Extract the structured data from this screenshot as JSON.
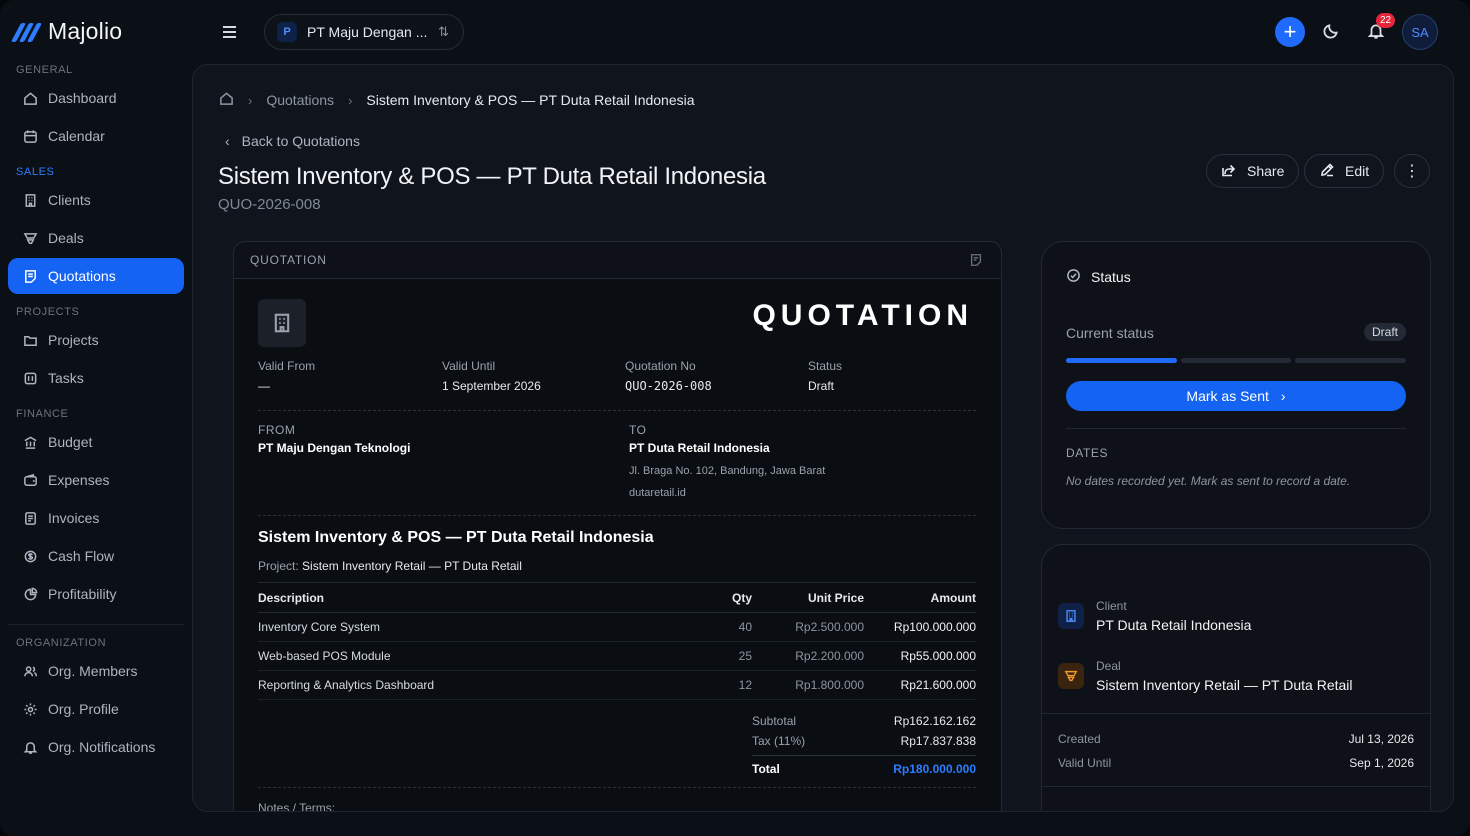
{
  "app": {
    "name": "Majolio"
  },
  "sidebar": {
    "sections": {
      "general": "GENERAL",
      "sales": "SALES",
      "projects": "PROJECTS",
      "finance": "FINANCE",
      "organization": "ORGANIZATION"
    },
    "items": {
      "dashboard": "Dashboard",
      "calendar": "Calendar",
      "clients": "Clients",
      "deals": "Deals",
      "quotations": "Quotations",
      "projects": "Projects",
      "tasks": "Tasks",
      "budget": "Budget",
      "expenses": "Expenses",
      "invoices": "Invoices",
      "cashflow": "Cash Flow",
      "profitability": "Profitability",
      "members": "Org. Members",
      "profile": "Org. Profile",
      "notifications": "Org. Notifications"
    }
  },
  "topbar": {
    "org_initial": "P",
    "org_name": "PT Maju Dengan ...",
    "notification_count": "22",
    "avatar_initials": "SA",
    "accent": "#1f6bff"
  },
  "breadcrumb": {
    "quotations": "Quotations",
    "current": "Sistem Inventory & POS — PT Duta Retail Indonesia"
  },
  "page": {
    "back_label": "Back to Quotations",
    "title": "Sistem Inventory & POS — PT Duta Retail Indonesia",
    "code": "QUO-2026-008",
    "share_label": "Share",
    "edit_label": "Edit"
  },
  "quotation": {
    "card_label": "QUOTATION",
    "doc_title": "QUOTATION",
    "meta": {
      "valid_from_label": "Valid From",
      "valid_from": "—",
      "valid_until_label": "Valid Until",
      "valid_until": "1 September 2026",
      "number_label": "Quotation No",
      "number": "QUO-2026-008",
      "status_label": "Status",
      "status": "Draft"
    },
    "from": {
      "label": "FROM",
      "name": "PT Maju Dengan Teknologi"
    },
    "to": {
      "label": "TO",
      "name": "PT Duta Retail Indonesia",
      "address": "Jl. Braga No. 102, Bandung, Jawa Barat",
      "website": "dutaretail.id"
    },
    "project_title": "Sistem Inventory & POS — PT Duta Retail Indonesia",
    "project_label": "Project:",
    "project_name": "Sistem Inventory Retail — PT Duta Retail",
    "columns": {
      "description": "Description",
      "qty": "Qty",
      "unit_price": "Unit Price",
      "amount": "Amount"
    },
    "items": [
      {
        "description": "Inventory Core System",
        "qty": "40",
        "unit_price": "Rp2.500.000",
        "amount": "Rp100.000.000"
      },
      {
        "description": "Web-based POS Module",
        "qty": "25",
        "unit_price": "Rp2.200.000",
        "amount": "Rp55.000.000"
      },
      {
        "description": "Reporting & Analytics Dashboard",
        "qty": "12",
        "unit_price": "Rp1.800.000",
        "amount": "Rp21.600.000"
      }
    ],
    "totals": {
      "subtotal_label": "Subtotal",
      "subtotal": "Rp162.162.162",
      "tax_label": "Tax (11%)",
      "tax": "Rp17.837.838",
      "total_label": "Total",
      "total": "Rp180.000.000"
    },
    "notes_label": "Notes / Terms:"
  },
  "status_card": {
    "title": "Status",
    "current_label": "Current status",
    "current_value": "Draft",
    "progress_step": 1,
    "progress_steps": 3,
    "mark_button": "Mark as Sent",
    "dates_label": "DATES",
    "dates_empty": "No dates recorded yet. Mark as sent to record a date."
  },
  "info_card": {
    "client_label": "Client",
    "client_name": "PT Duta Retail Indonesia",
    "deal_label": "Deal",
    "deal_name": "Sistem Inventory Retail — PT Duta Retail",
    "created_label": "Created",
    "created": "Jul 13, 2026",
    "valid_until_label": "Valid Until",
    "valid_until": "Sep 1, 2026"
  }
}
